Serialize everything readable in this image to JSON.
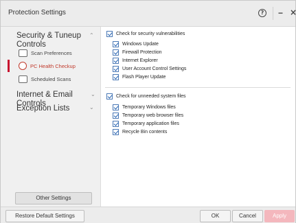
{
  "window": {
    "title": "Protection Settings",
    "help_glyph": "?",
    "minimize_glyph": "−",
    "close_glyph": "×"
  },
  "sidebar": {
    "sections": [
      {
        "label": "Security & Tuneup Controls",
        "expanded": true
      },
      {
        "label": "Internet & Email Controls",
        "expanded": false
      },
      {
        "label": "Exception Lists",
        "expanded": false
      }
    ],
    "items": [
      {
        "label": "Scan Preferences",
        "icon": "scan-preferences-icon",
        "active": false
      },
      {
        "label": "PC Health Checkup",
        "icon": "pc-health-checkup-icon",
        "active": true
      },
      {
        "label": "Scheduled Scans",
        "icon": "calendar-icon",
        "active": false
      }
    ],
    "other_settings_label": "Other Settings",
    "accent_color": "#c8102e"
  },
  "main": {
    "groups": [
      {
        "label": "Check for security vulnerabilities",
        "checked": true,
        "options": [
          {
            "label": "Windows Update",
            "checked": true
          },
          {
            "label": "Firewall Protection",
            "checked": true
          },
          {
            "label": "Internet Explorer",
            "checked": true
          },
          {
            "label": "User Account Control Settings",
            "checked": true
          },
          {
            "label": "Flash Player Update",
            "checked": true
          }
        ]
      },
      {
        "label": "Check for unneeded system files",
        "checked": true,
        "options": [
          {
            "label": "Temporary Windows files",
            "checked": true
          },
          {
            "label": "Temporary web browser files",
            "checked": true
          },
          {
            "label": "Temporary application files",
            "checked": true
          },
          {
            "label": "Recycle Bin contents",
            "checked": true
          }
        ]
      }
    ]
  },
  "footer": {
    "restore_label": "Restore Default Settings",
    "ok_label": "OK",
    "cancel_label": "Cancel",
    "apply_label": "Apply",
    "apply_color": "#f4b7bd"
  }
}
